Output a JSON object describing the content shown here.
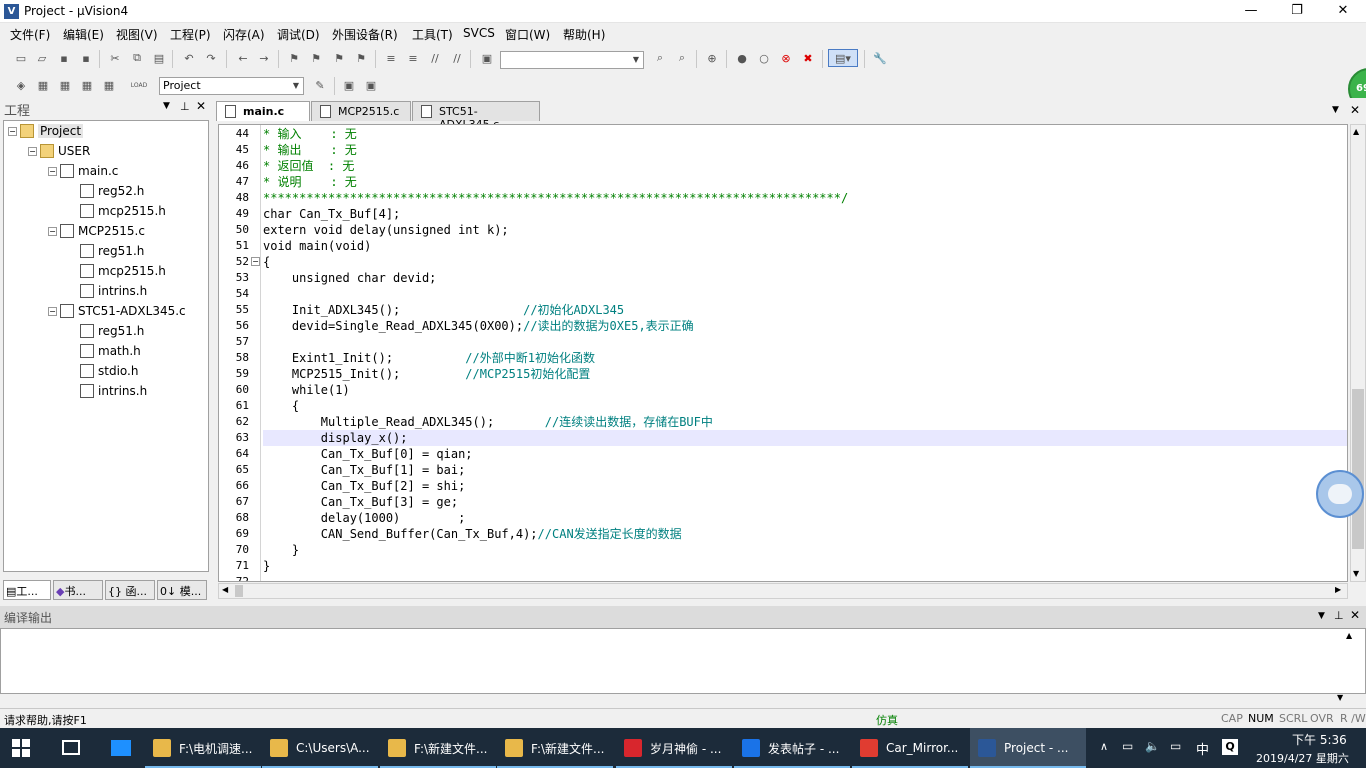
{
  "window": {
    "title": "Project  -  µVision4"
  },
  "menu": [
    "文件(F)",
    "编辑(E)",
    "视图(V)",
    "工程(P)",
    "闪存(A)",
    "调试(D)",
    "外围设备(R)",
    "工具(T)",
    "SVCS",
    "窗口(W)",
    "帮助(H)"
  ],
  "toolbar2": {
    "target_combo": "Project",
    "load_label": "LOAD"
  },
  "project_panel": {
    "title": "工程",
    "tree": [
      {
        "label": "Project",
        "level": 0,
        "type": "proj",
        "exp": "−"
      },
      {
        "label": "USER",
        "level": 1,
        "type": "folder",
        "exp": "−"
      },
      {
        "label": "main.c",
        "level": 2,
        "type": "cfile",
        "exp": "−"
      },
      {
        "label": "reg52.h",
        "level": 3,
        "type": "hfile"
      },
      {
        "label": "mcp2515.h",
        "level": 3,
        "type": "hfile"
      },
      {
        "label": "MCP2515.c",
        "level": 2,
        "type": "cfile",
        "exp": "−"
      },
      {
        "label": "reg51.h",
        "level": 3,
        "type": "hfile"
      },
      {
        "label": "mcp2515.h",
        "level": 3,
        "type": "hfile"
      },
      {
        "label": "intrins.h",
        "level": 3,
        "type": "hfile"
      },
      {
        "label": "STC51-ADXL345.c",
        "level": 2,
        "type": "cfile",
        "exp": "−"
      },
      {
        "label": "reg51.h",
        "level": 3,
        "type": "hfile"
      },
      {
        "label": "math.h",
        "level": 3,
        "type": "hfile"
      },
      {
        "label": "stdio.h",
        "level": 3,
        "type": "hfile"
      },
      {
        "label": "intrins.h",
        "level": 3,
        "type": "hfile"
      }
    ],
    "tabs": [
      "工...",
      "书...",
      "{} 函...",
      "0↓ 模..."
    ]
  },
  "editor": {
    "tabs": [
      "main.c",
      "MCP2515.c",
      "STC51-ADXL345.c"
    ],
    "lines": [
      {
        "n": "44",
        "t": "* 输入    : 无",
        "k": "cmt"
      },
      {
        "n": "45",
        "t": "* 输出    : 无",
        "k": "cmt"
      },
      {
        "n": "46",
        "t": "* 返回值  : 无",
        "k": "cmt"
      },
      {
        "n": "47",
        "t": "* 说明    : 无",
        "k": "cmt"
      },
      {
        "n": "48",
        "t": "********************************************************************************/",
        "k": "cmt"
      },
      {
        "n": "49",
        "t": "char Can_Tx_Buf[4];",
        "k": ""
      },
      {
        "n": "50",
        "t": "extern void delay(unsigned int k);",
        "k": ""
      },
      {
        "n": "51",
        "t": "void main(void)",
        "k": ""
      },
      {
        "n": "52",
        "t": "{",
        "k": ""
      },
      {
        "n": "53",
        "t": "    unsigned char devid;",
        "k": ""
      },
      {
        "n": "54",
        "t": "",
        "k": ""
      },
      {
        "n": "55",
        "t": "    Init_ADXL345();",
        "c": "                 //初始化ADXL345",
        "k": ""
      },
      {
        "n": "56",
        "t": "    devid=Single_Read_ADXL345(0X00);",
        "c": "//读出的数据为0XE5,表示正确",
        "k": ""
      },
      {
        "n": "57",
        "t": "",
        "k": ""
      },
      {
        "n": "58",
        "t": "    Exint1_Init();",
        "c": "          //外部中断1初始化函数",
        "k": ""
      },
      {
        "n": "59",
        "t": "    MCP2515_Init();",
        "c": "         //MCP2515初始化配置",
        "k": ""
      },
      {
        "n": "60",
        "t": "    while(1)",
        "k": ""
      },
      {
        "n": "61",
        "t": "    {",
        "k": ""
      },
      {
        "n": "62",
        "t": "        Multiple_Read_ADXL345();",
        "c": "       //连续读出数据，存储在BUF中",
        "k": ""
      },
      {
        "n": "63",
        "t": "        display_x();",
        "k": "cur"
      },
      {
        "n": "64",
        "t": "        Can_Tx_Buf[0] = qian;",
        "k": ""
      },
      {
        "n": "65",
        "t": "        Can_Tx_Buf[1] = bai;",
        "k": ""
      },
      {
        "n": "66",
        "t": "        Can_Tx_Buf[2] = shi;",
        "k": ""
      },
      {
        "n": "67",
        "t": "        Can_Tx_Buf[3] = ge;",
        "k": ""
      },
      {
        "n": "68",
        "t": "        delay(1000)        ;",
        "k": ""
      },
      {
        "n": "69",
        "t": "        CAN_Send_Buffer(Can_Tx_Buf,4);",
        "c": "//CAN发送指定长度的数据",
        "k": ""
      },
      {
        "n": "70",
        "t": "    }",
        "k": ""
      },
      {
        "n": "71",
        "t": "}",
        "k": ""
      },
      {
        "n": "72",
        "t": "",
        "k": ""
      }
    ]
  },
  "output": {
    "title": "编译输出"
  },
  "status": {
    "help": "请求帮助,请按F1",
    "mode": "仿真",
    "cap": "CAP",
    "num": "NUM",
    "scrl": "SCRL",
    "ovr": "OVR",
    "rw": "R /W"
  },
  "taskbar": {
    "items": [
      "F:\\电机调速...",
      "C:\\Users\\A...",
      "F:\\新建文件...",
      "F:\\新建文件...",
      "岁月神偷 - ...",
      "发表帖子 - ...",
      "Car_Mirror...",
      "Project  - ..."
    ],
    "time": "下午 5:36",
    "date": "2019/4/27 星期六",
    "ime": "中"
  },
  "badge": "69",
  "colors": {
    "taskbar": "#1c2b3a",
    "accent": "#76b9ed",
    "comment": "#008000"
  }
}
